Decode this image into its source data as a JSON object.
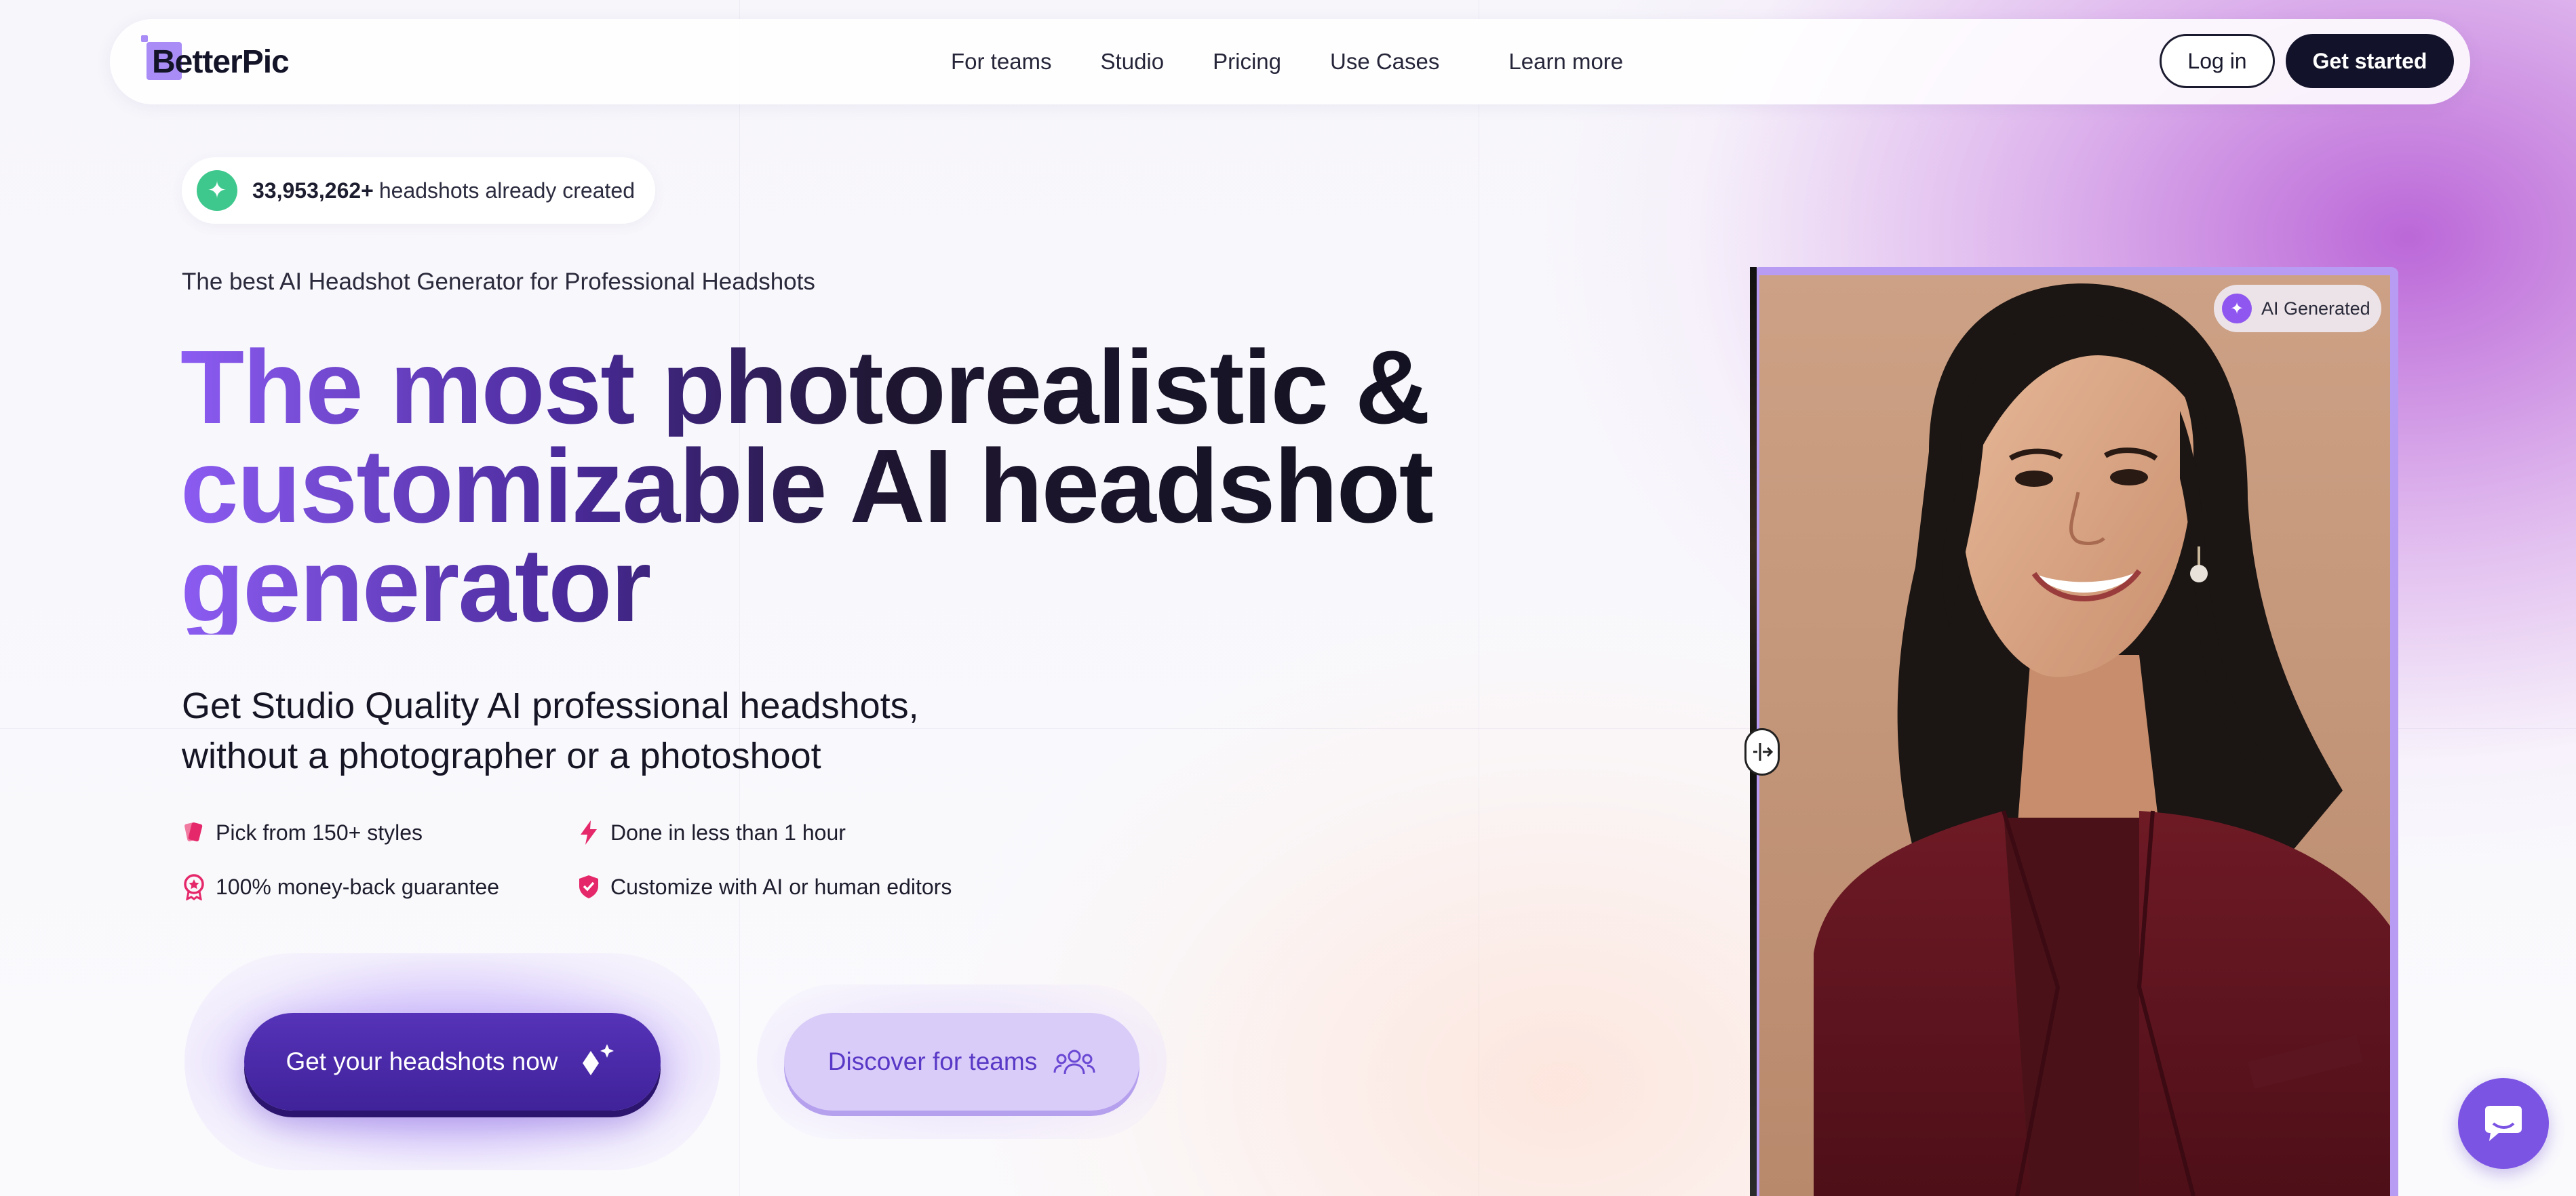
{
  "nav": {
    "logo": "BetterPic",
    "links": [
      "For teams",
      "Studio",
      "Pricing",
      "Use Cases",
      "Learn more"
    ],
    "login": "Log in",
    "get_started": "Get started"
  },
  "badge": {
    "count": "33,953,262+",
    "text": "headshots already created"
  },
  "hero": {
    "subtitle": "The best AI Headshot Generator for Professional Headshots",
    "headline": [
      "The most photorealistic &",
      "customizable AI headshot",
      "generator"
    ],
    "lead": [
      "Get Studio Quality AI professional headshots,",
      "without a photographer or a photoshoot"
    ],
    "features": [
      {
        "icon": "styles-icon",
        "text": "Pick from 150+ styles"
      },
      {
        "icon": "lightning-icon",
        "text": "Done in less than 1 hour"
      },
      {
        "icon": "award-icon",
        "text": "100% money-back guarantee"
      },
      {
        "icon": "shield-icon",
        "text": "Customize with AI or human editors"
      }
    ],
    "cta_primary": "Get your headshots now",
    "cta_secondary": "Discover for teams"
  },
  "photo": {
    "label": "AI Generated"
  },
  "colors": {
    "accent": "#7c54e4",
    "primary_button": "#40229a",
    "feature_icons": "#e5286a",
    "badge_icon": "#3fc88d"
  }
}
